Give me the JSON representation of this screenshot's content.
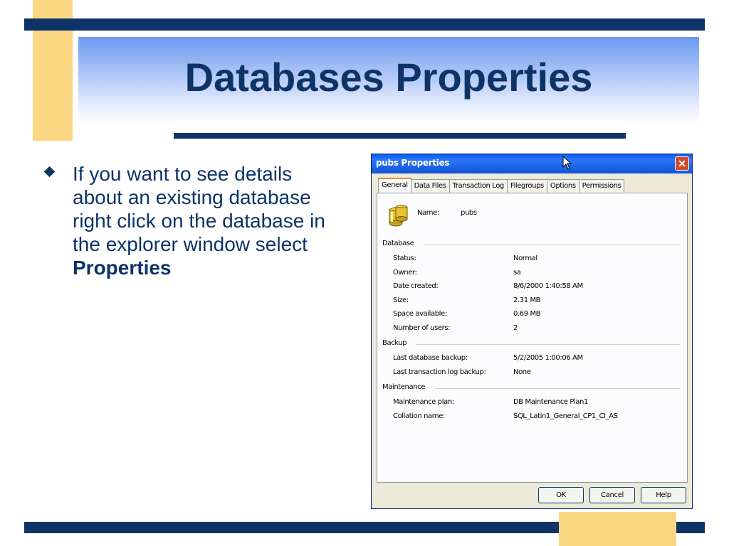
{
  "slide": {
    "title": "Databases Properties",
    "bullet_text": "If you want to see details about an existing database right click on the database in the explorer window select ",
    "bullet_bold": "Properties"
  },
  "dialog": {
    "title": "pubs Properties",
    "tabs": [
      "General",
      "Data Files",
      "Transaction Log",
      "Filegroups",
      "Options",
      "Permissions"
    ],
    "active_tab": "General",
    "name_label": "Name:",
    "name_value": "pubs",
    "sections": [
      {
        "heading": "Database",
        "rows": [
          {
            "label": "Status:",
            "value": "Normal"
          },
          {
            "label": "Owner:",
            "value": "sa"
          },
          {
            "label": "Date created:",
            "value": "8/6/2000 1:40:58 AM"
          },
          {
            "label": "Size:",
            "value": "2.31 MB"
          },
          {
            "label": "Space available:",
            "value": "0.69 MB"
          },
          {
            "label": "Number of users:",
            "value": "2"
          }
        ]
      },
      {
        "heading": "Backup",
        "rows": [
          {
            "label": "Last database backup:",
            "value": "5/2/2005 1:00:06 AM"
          },
          {
            "label": "Last transaction log backup:",
            "value": "None"
          }
        ]
      },
      {
        "heading": "Maintenance",
        "rows": [
          {
            "label": "Maintenance plan:",
            "value": "DB Maintenance Plan1"
          },
          {
            "label": "Collation name:",
            "value": "SQL_Latin1_General_CP1_CI_AS"
          }
        ]
      }
    ],
    "buttons": {
      "ok": "OK",
      "cancel": "Cancel",
      "help": "Help"
    }
  },
  "colors": {
    "navy": "#0d3367",
    "accent_yellow": "#fbd784",
    "titlebar_blue": "#0a5cf0",
    "close_red": "#d64a2c"
  },
  "icons": [
    "database-icon",
    "close-icon",
    "mouse-cursor-icon",
    "bullet-diamond-icon"
  ]
}
